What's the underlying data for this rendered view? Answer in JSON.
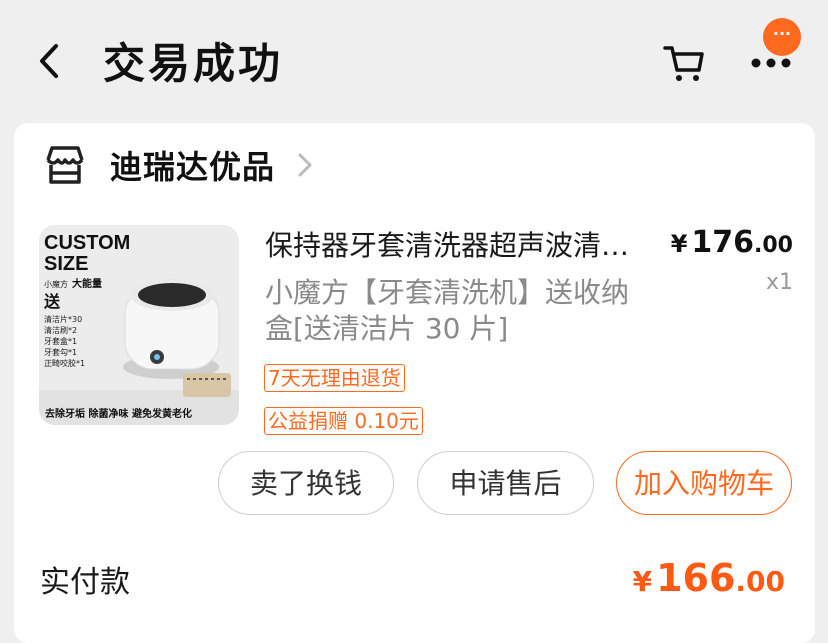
{
  "header": {
    "title": "交易成功",
    "badge": "···",
    "back_icon": "chevron-left-icon",
    "cart_icon": "cart-icon",
    "more_icon": "more-dots-icon"
  },
  "shop": {
    "name": "迪瑞达优品",
    "icon": "store-icon"
  },
  "product": {
    "image_text": {
      "line1": "CUSTOM",
      "line2": "SIZE",
      "sub_small": "小魔方",
      "sub_big": "大能量",
      "gift": "送",
      "items": [
        "清洁片*30",
        "清洁刷*2",
        "牙套盒*1",
        "牙套勾*1",
        "正畸咬胶*1"
      ],
      "bottom": "去除牙垢 除菌净味 避免发黄老化"
    },
    "title": "保持器牙套清洗器超声波清洗机",
    "spec": "小魔方【牙套清洗机】送收纳盒[送清洁片 30 片]",
    "price_symbol": "¥",
    "price_int": "176",
    "price_dec": ".00",
    "quantity": "x1",
    "tags": [
      "7天无理由退货",
      "公益捐赠 0.10元"
    ]
  },
  "actions": {
    "sell": "卖了换钱",
    "after_sale": "申请售后",
    "add_to_cart": "加入购物车"
  },
  "payment": {
    "label": "实付款",
    "symbol": "¥",
    "int": "166",
    "dec": ".00"
  },
  "colors": {
    "accent": "#ff6a1f",
    "price_red": "#ff5a14",
    "background": "#efefef"
  }
}
